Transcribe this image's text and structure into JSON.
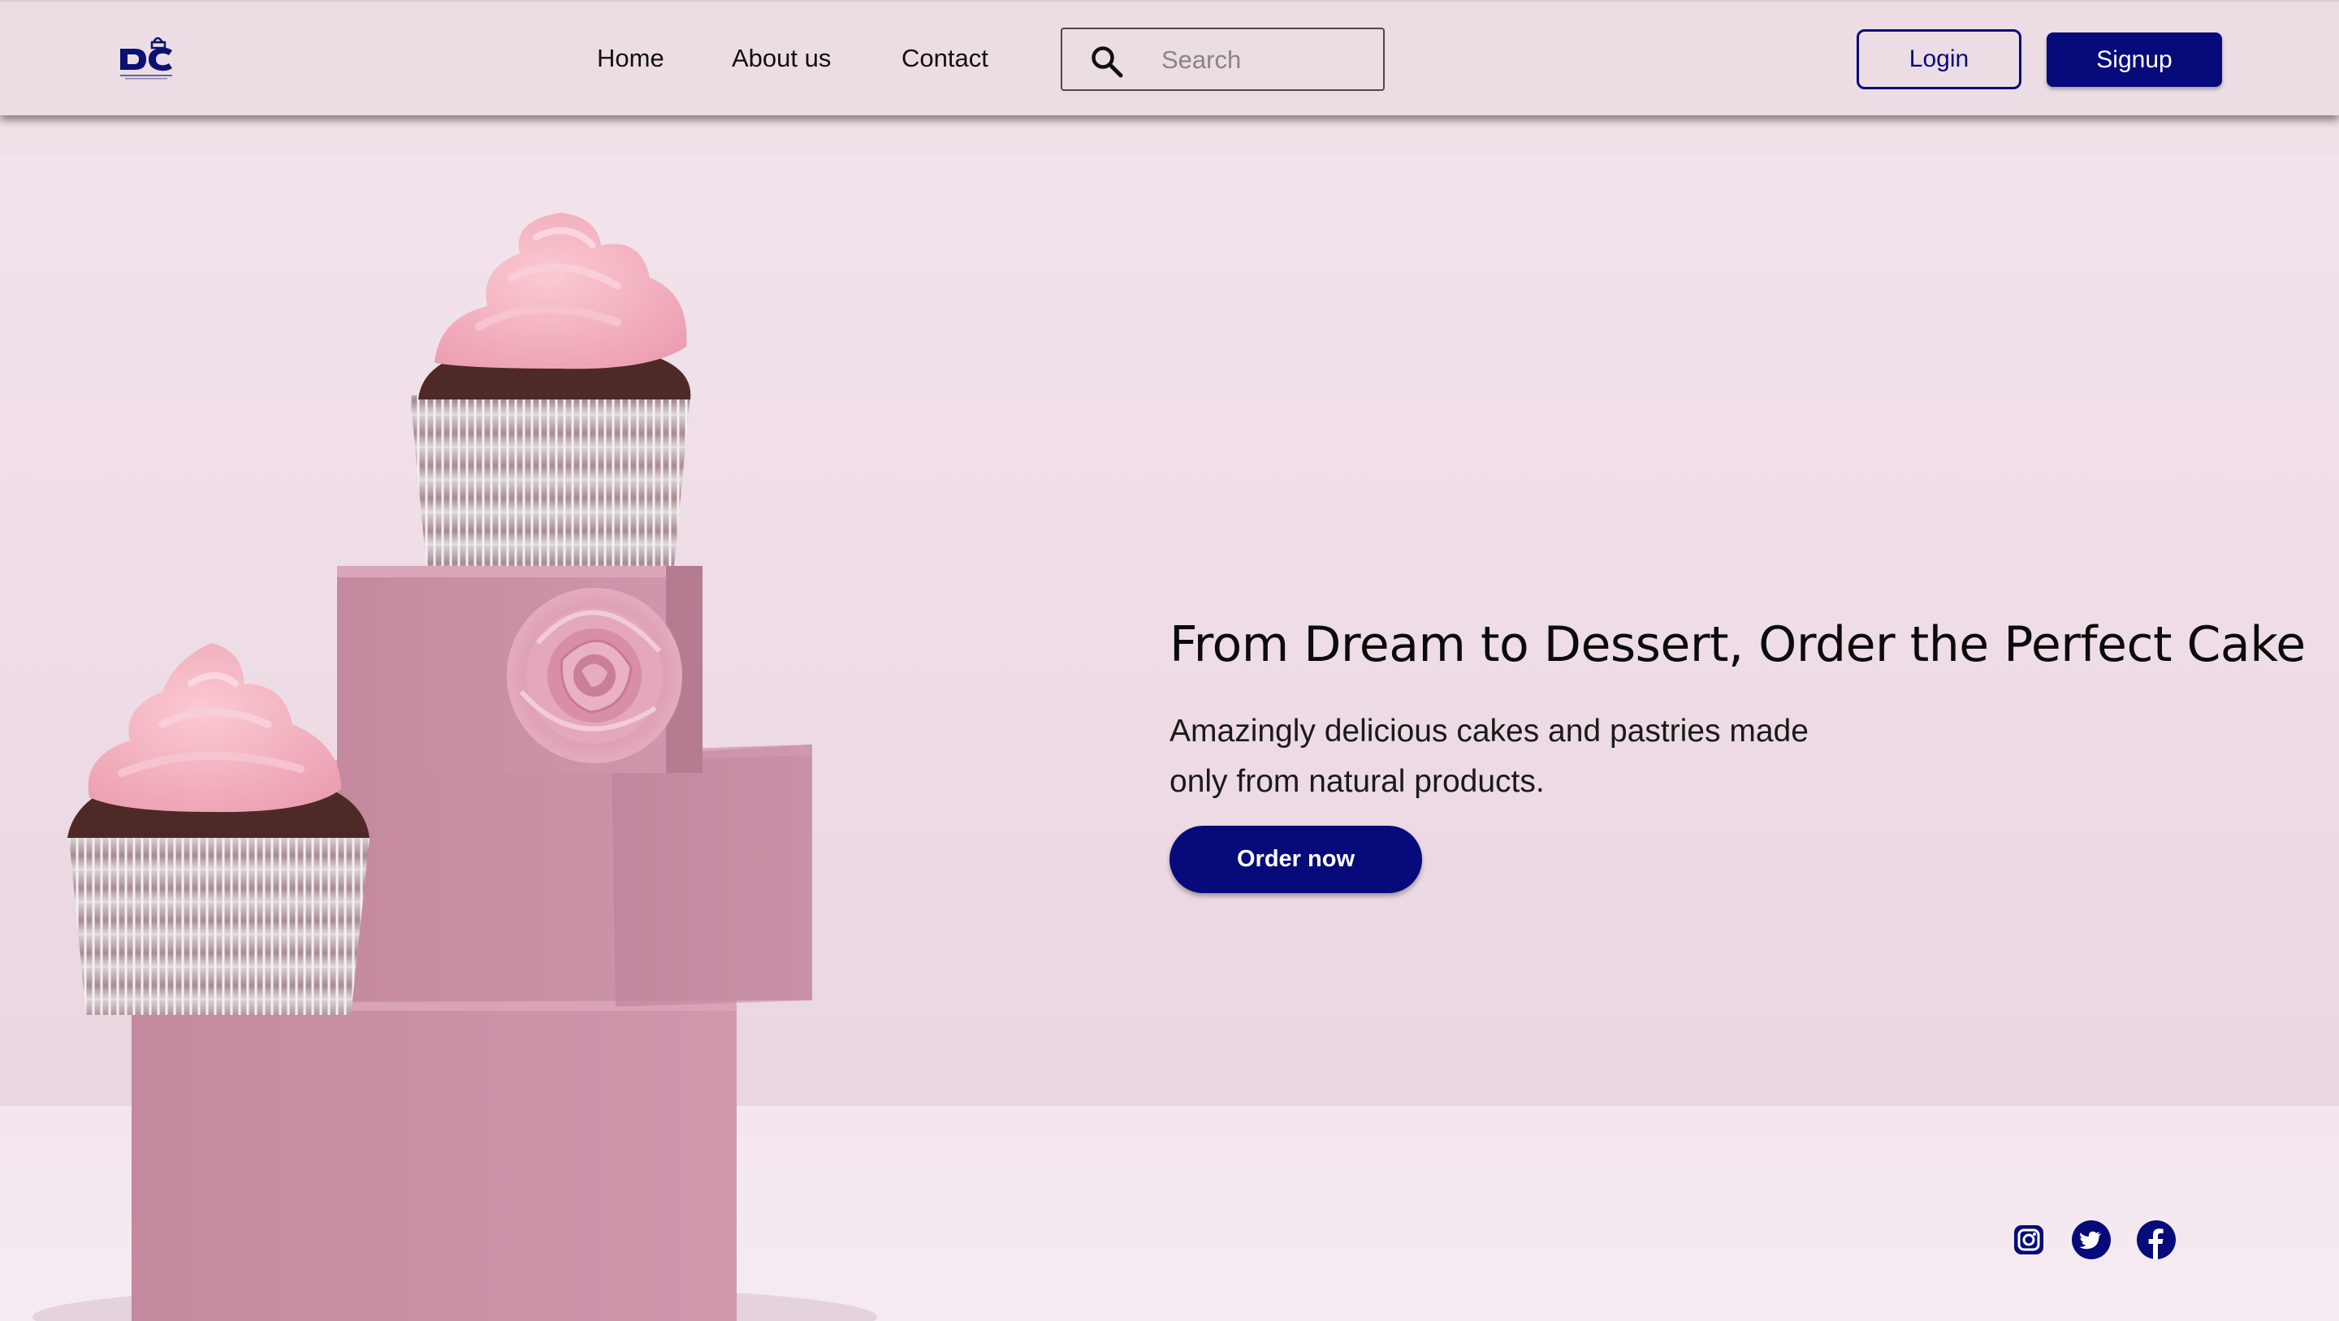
{
  "brand": {
    "logo_icon": "dc-cake-logo"
  },
  "nav": {
    "links": [
      "Home",
      "About us",
      "Contact"
    ],
    "search": {
      "placeholder": "Search",
      "icon": "search-icon"
    },
    "login_label": "Login",
    "signup_label": "Signup"
  },
  "hero": {
    "title": "From Dream to Dessert, Order the Perfect Cake",
    "subtitle_line1": "Amazingly delicious cakes and pastries made",
    "subtitle_line2": "only from natural products.",
    "cta_label": "Order now"
  },
  "social": {
    "icons": [
      "instagram-icon",
      "twitter-icon",
      "facebook-icon"
    ]
  },
  "colors": {
    "accent": "#070a7a",
    "nav_bg": "#ecdde5",
    "hero_bg": "#f0e2e9",
    "box_pink": "#c98fa8",
    "frosting": "#f3aebd"
  }
}
